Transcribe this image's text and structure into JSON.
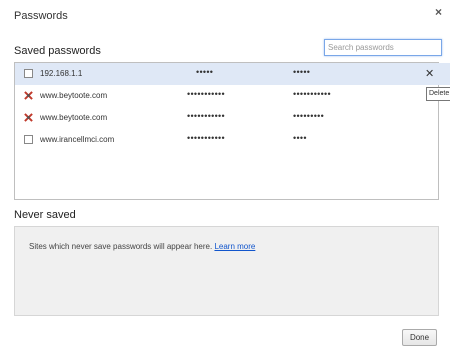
{
  "dialog": {
    "title": "Passwords",
    "close_glyph": "×"
  },
  "saved": {
    "heading": "Saved passwords",
    "search_placeholder": "Search passwords",
    "rows": [
      {
        "site": "192.168.1.1",
        "icon": "document-icon",
        "user": "•••••",
        "password": "•••••"
      },
      {
        "site": "www.beytoote.com",
        "icon": "site-favicon",
        "user": "•••••••••••",
        "password": "•••••••••••"
      },
      {
        "site": "www.beytoote.com",
        "icon": "site-favicon",
        "user": "•••••••••••",
        "password": "•••••••••"
      },
      {
        "site": "www.irancellmci.com",
        "icon": "document-icon",
        "user": "•••••••••••",
        "password": "••••"
      }
    ],
    "delete_glyph": "✕",
    "delete_tooltip": "Delete"
  },
  "never": {
    "heading": "Never saved",
    "message": "Sites which never save passwords will appear here.",
    "link": "Learn more"
  },
  "footer": {
    "done_label": "Done"
  }
}
